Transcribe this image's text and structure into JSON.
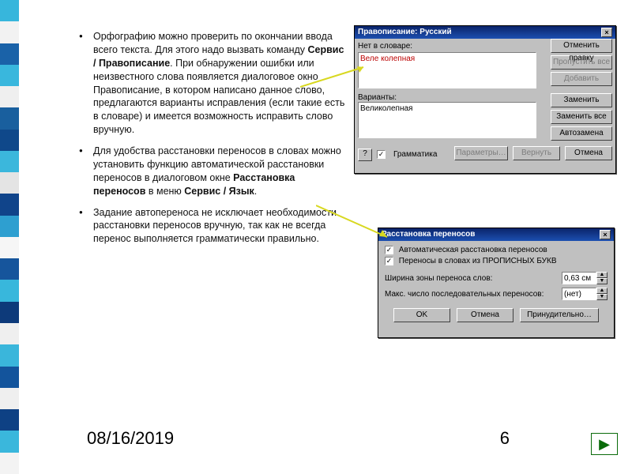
{
  "stripes": [
    "#37b6dc",
    "#f2f2f2",
    "#1a62a8",
    "#39b7dd",
    "#efefef",
    "#195f9e",
    "#0f488a",
    "#3bb7dc",
    "#e4e4e4",
    "#10448a",
    "#2e9fd0",
    "#f6f6f6",
    "#16559c",
    "#38b7dc",
    "#0d3a7a",
    "#efefef",
    "#3ab6db",
    "#13549c",
    "#efefef",
    "#0e4184",
    "#3ab7dc",
    "#f3f3f3"
  ],
  "bullets": [
    "Орфографию можно проверить по окончании ввода всего текста. Для этого надо вызвать команду <b>Сервис / Правописание</b>. При обнаружении ошибки или неизвестного слова появляется диалоговое окно Правописание, в котором написано данное слово, предлагаются варианты исправления (если такие есть в словаре) и имеется возможность исправить слово вручную.",
    "Для удобства расстановки переносов в словах можно установить функцию автоматической расстановки переносов в диалоговом окне <b>Расстановка переносов</b> в меню <b>Сервис / Язык</b>.",
    "Задание автопереноса не исключает необходимости расстановки переносов вручную, так как не всегда перенос выполняется грамматически правильно."
  ],
  "footer": {
    "date": "08/16/2019",
    "page": "6"
  },
  "dlg1": {
    "title": "Правописание: Русский",
    "not_in_dict": "Нет в словаре:",
    "word": "Веле колепная",
    "variants_label": "Варианты:",
    "variant": "Великолепная",
    "grammar": "Грамматика",
    "buttons": {
      "undo": "Отменить правку",
      "skip_all": "Пропустить все",
      "add": "Добавить",
      "replace": "Заменить",
      "replace_all": "Заменить все",
      "autoreplace": "Автозамена",
      "params": "Параметры…",
      "revert": "Вернуть",
      "cancel": "Отмена"
    }
  },
  "dlg2": {
    "title": "Расстановка переносов",
    "auto": "Автоматическая расстановка переносов",
    "caps": "Переносы в словах из ПРОПИСНЫХ БУКВ",
    "width_label": "Ширина зоны переноса слов:",
    "width_val": "0,63 см",
    "max_label": "Макс. число последовательных переносов:",
    "max_val": "(нет)",
    "ok": "OK",
    "cancel": "Отмена",
    "force": "Принудительно…"
  }
}
